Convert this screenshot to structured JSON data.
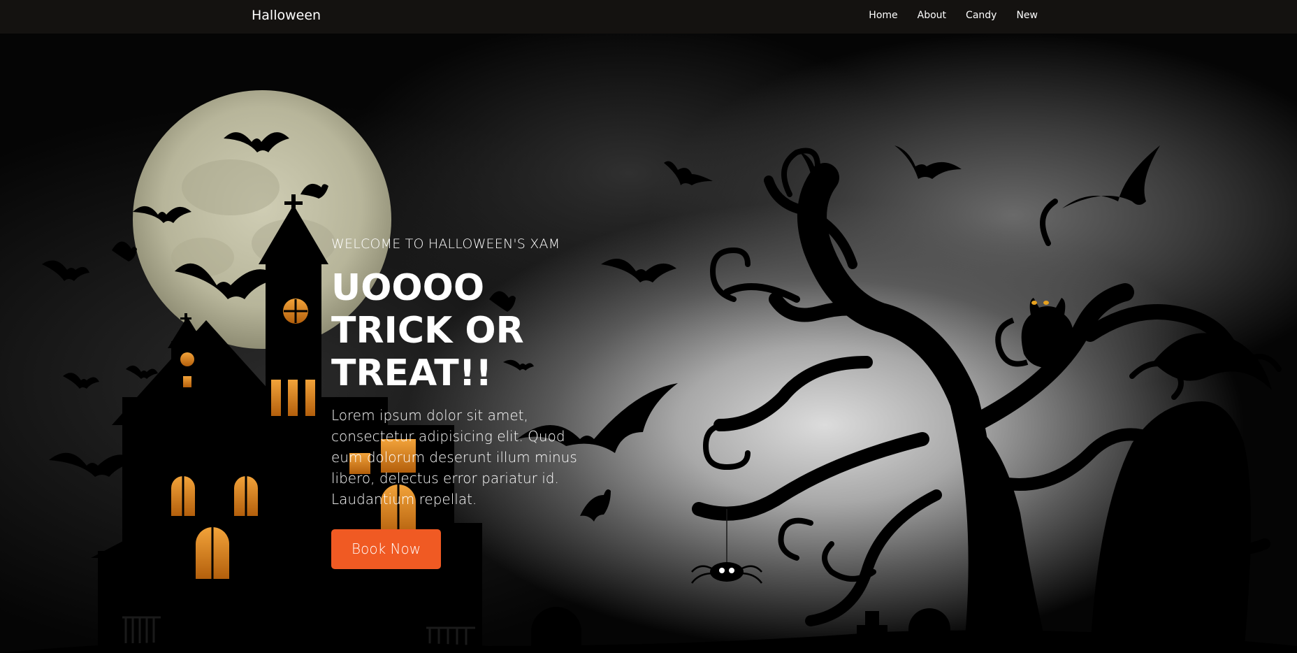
{
  "nav": {
    "brand": "Halloween",
    "links": [
      "Home",
      "About",
      "Candy",
      "New"
    ]
  },
  "hero": {
    "eyebrow": "WELCOME TO HALLOWEEN'S XAM",
    "title_lines": [
      "UOOOO",
      "TRICK OR",
      "TREAT!!"
    ],
    "description": "Lorem ipsum dolor sit amet, consectetur adipisicing elit. Quod eum dolorum deserunt illum minus libero, delectus error pariatur id. Laudantium repellat.",
    "cta": "Book Now"
  },
  "colors": {
    "nav_bg": "#141210",
    "accent": "#f05a23",
    "moon": "#c8c6aa",
    "window_glow": "#e08a1a"
  }
}
